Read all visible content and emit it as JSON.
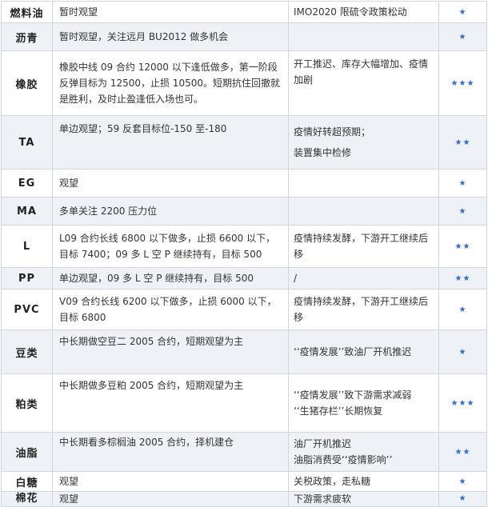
{
  "rows": [
    {
      "name": "燃料油",
      "strategy": [
        "暂时观望"
      ],
      "reasons": [
        "IMO2020 限硫令政策松动"
      ],
      "stars": "★"
    },
    {
      "name": "沥青",
      "strategy": [
        "暂时观望，关注远月 BU2012 做多机会"
      ],
      "reasons": [
        ""
      ],
      "stars": "★"
    },
    {
      "name": "橡胶",
      "strategy": [
        "橡胶中线 09 合约 12000 以下逢低做多，第一阶段反弹目标为 12500，止损 10500。短期抗住回撤就是胜利，及时止盈逢低入场也可。"
      ],
      "reasons": [
        "开工推迟、库存大幅增加、疫情加剧"
      ],
      "stars": "★★★"
    },
    {
      "name": "TA",
      "strategy": [
        "单边观望；59 反套目标位-150 至-180"
      ],
      "reasons": [
        "疫情好转超预期；",
        "装置集中检修"
      ],
      "stars": "★★"
    },
    {
      "name": "EG",
      "strategy": [
        "观望"
      ],
      "reasons": [
        ""
      ],
      "stars": "★"
    },
    {
      "name": "MA",
      "strategy": [
        "多单关注 2200 压力位"
      ],
      "reasons": [
        ""
      ],
      "stars": "★"
    },
    {
      "name": "L",
      "strategy": [
        "L09 合约长线 6800 以下做多，止损 6600 以下，目标 7400；09 多 L 空 P 继续持有，目标 500"
      ],
      "reasons": [
        "疫情持续发酵，下游开工继续后移"
      ],
      "stars": "★★"
    },
    {
      "name": "PP",
      "strategy": [
        "单边观望，09 多 L 空 P 继续持有，目标 500"
      ],
      "reasons": [
        "/"
      ],
      "stars": "★★"
    },
    {
      "name": "PVC",
      "strategy": [
        "V09 合约长线 6200 以下做多，止损 6000 以下，目标 6800"
      ],
      "reasons": [
        "疫情持续发酵，下游开工继续后移"
      ],
      "stars": "★"
    },
    {
      "name": "豆类",
      "strategy": [
        "中长期做空豆二 2005 合约，短期观望为主"
      ],
      "reasons": [
        "‘‘疫情发展’’致油厂开机推迟"
      ],
      "stars": "★"
    },
    {
      "name": "粕类",
      "strategy": [
        "中长期做多豆粕 2005 合约，短期观望为主"
      ],
      "reasons": [
        "‘‘疫情发展’’致下游需求减弱",
        "‘‘生猪存栏’’长期恢复"
      ],
      "stars": "★★★"
    },
    {
      "name": "油脂",
      "strategy": [
        "中长期看多棕榈油 2005 合约，择机建仓"
      ],
      "reasons": [
        "油厂开机推迟",
        "油脂消费受‘‘疫情影响’’"
      ],
      "stars": "★★"
    },
    {
      "name": "白糖",
      "strategy": [
        "观望"
      ],
      "reasons": [
        "关税政策，走私糖"
      ],
      "stars": "★"
    },
    {
      "name": "棉花",
      "strategy": [
        "观望"
      ],
      "reasons": [
        "下游需求疲软"
      ],
      "stars": "★"
    }
  ]
}
